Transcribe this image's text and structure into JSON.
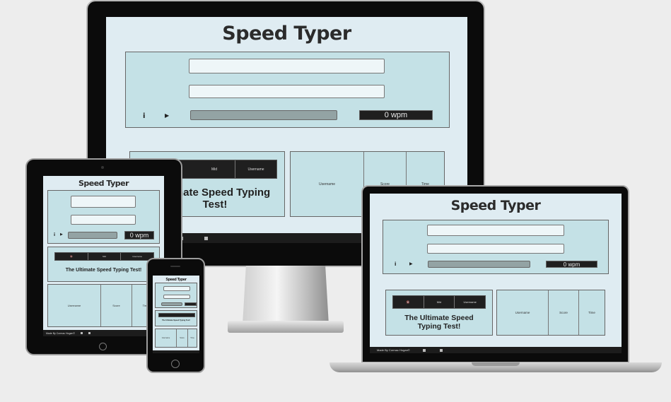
{
  "app": {
    "title": "Speed Typer",
    "wpm": "0 wpm",
    "info_icon": "i",
    "play_icon": "▶",
    "mute_icon": "🔇",
    "tabs": [
      "Mute",
      "Mid",
      "Username"
    ],
    "tabs_short": [
      "🔇",
      "Mid",
      "Username"
    ],
    "heading": "The Ultimate Speed Typing Test!",
    "heading_partial_1": "mate Speed Typing",
    "heading_partial_2": "Test!",
    "table_headers": [
      "Username",
      "Score",
      "Time"
    ],
    "footer_text": "Made By Cormac Hogan©"
  }
}
